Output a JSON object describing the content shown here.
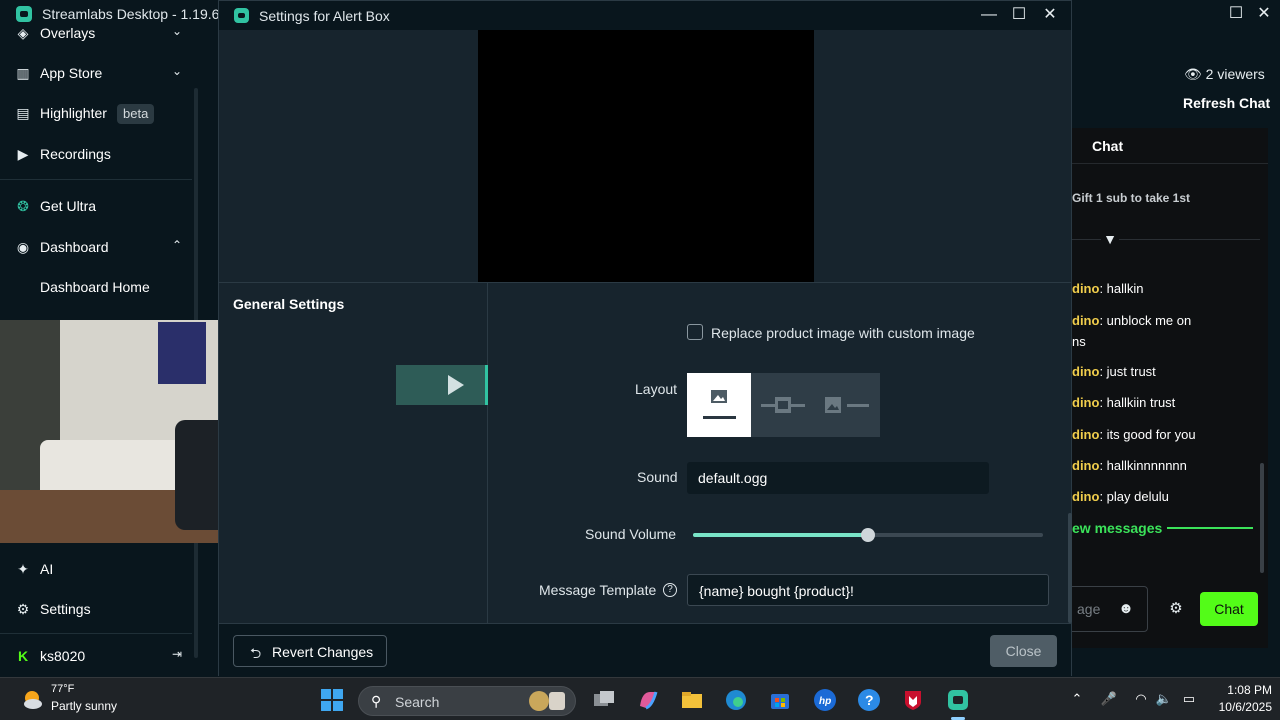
{
  "app": {
    "title": "Streamlabs Desktop - 1.19.6",
    "minimize": "—",
    "maximize": "☐",
    "close": "✕"
  },
  "sidebar": {
    "items": [
      {
        "label": "Overlays",
        "icon": "overlays-icon",
        "glyph": "◈",
        "chevron": "⌄"
      },
      {
        "label": "App Store",
        "icon": "store-icon",
        "glyph": "▥",
        "chevron": "⌄"
      },
      {
        "label": "Highlighter",
        "icon": "clapperboard-icon",
        "glyph": "▤",
        "badge": "beta"
      },
      {
        "label": "Recordings",
        "icon": "play-circle-icon",
        "glyph": "▶"
      },
      {
        "label": "Get Ultra",
        "icon": "ultra-icon",
        "glyph": "❂"
      },
      {
        "label": "Dashboard",
        "icon": "dashboard-icon",
        "glyph": "◉",
        "chevron": "⌃"
      },
      {
        "label": "Dashboard Home"
      },
      {
        "label": "AI",
        "icon": "sparkle-icon",
        "glyph": "✦"
      },
      {
        "label": "Settings",
        "icon": "gear-icon",
        "glyph": "⚙"
      },
      {
        "label": "ks8020",
        "icon": "kick-icon",
        "glyph": "K",
        "logout_glyph": "⇥"
      }
    ]
  },
  "chat": {
    "viewers": "2 viewers",
    "refresh": "Refresh Chat",
    "title": "Chat",
    "pinned": "Gift 1 sub to take 1st",
    "pin_glyph": "▼",
    "messages": [
      {
        "user": "dino",
        "text": ": hallkin"
      },
      {
        "user": "dino",
        "text": ": unblock me on"
      },
      {
        "user": "",
        "text": "ns"
      },
      {
        "user": "dino",
        "text": ": just trust"
      },
      {
        "user": "dino",
        "text": ": hallkiin trust"
      },
      {
        "user": "dino",
        "text": ": its good for you"
      },
      {
        "user": "dino",
        "text": ": hallkinnnnnnn"
      },
      {
        "user": "dino",
        "text": ": play delulu"
      }
    ],
    "new_messages": "ew messages",
    "input_placeholder": "age",
    "emoji_glyph": "☻",
    "gear_glyph": "⚙",
    "send_label": "Chat",
    "accent_color": "#53fc18",
    "username_color": "#f1ce4c"
  },
  "dialog": {
    "title": "Settings for Alert Box",
    "minimize": "—",
    "maximize": "☐",
    "close": "✕",
    "section": "General Settings",
    "checkbox_label": "Replace product image with custom image",
    "checkbox_checked": false,
    "layout_label": "Layout",
    "layout_selected": 0,
    "sound_label": "Sound",
    "sound_value": "default.ogg",
    "volume_label": "Sound Volume",
    "volume_value": 0.5,
    "template_label": "Message Template",
    "template_value": "{name} bought {product}!",
    "help_glyph": "?",
    "revert_label": "Revert Changes",
    "revert_glyph": "⮌",
    "close_label": "Close",
    "accent_color": "#31c3a2"
  },
  "taskbar": {
    "weather_temp": "77°F",
    "weather_desc": "Partly sunny",
    "search_label": "Search",
    "search_glyph": "⚲",
    "time": "1:08 PM",
    "date": "10/6/2025",
    "tray": {
      "chevron": "⌃",
      "mic": "🎤",
      "wifi": "◠",
      "volume": "🔈",
      "battery": "▭"
    }
  }
}
